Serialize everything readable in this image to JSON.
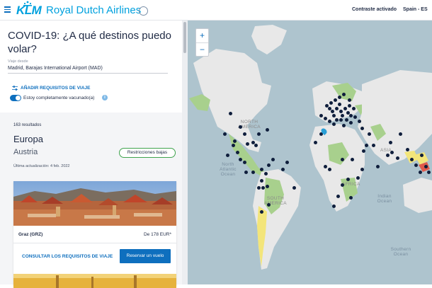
{
  "header": {
    "brand": "KLM",
    "airline_name": "Royal Dutch Airlines",
    "contrast_label": "Contraste activado",
    "language_label": "Spain - ES"
  },
  "sidebar": {
    "title": "COVID-19: ¿A qué destinos puedo volar?",
    "from_label": "Viaje desde",
    "from_value": "Madrid, Barajas International Airport (MAD)",
    "add_requirements": "AÑADIR REQUISITOS DE VIAJE",
    "vaccinated_label": "Estoy completamente vacunado(a)",
    "vaccinated_on": true,
    "info_glyph": "i",
    "results_count": "163 resultados",
    "region": "Europa",
    "country": "Austria",
    "restriction_badge": "Restricciones bajas",
    "last_update": "Última actualización: 4 feb. 2022",
    "destination": {
      "name": "Graz (GRZ)",
      "price": "De 178 EUR*",
      "requirements_link": "CONSULTAR LOS REQUISITOS DE VIAJE",
      "book_button": "Reservar un vuelo"
    }
  },
  "map": {
    "zoom_in": "+",
    "zoom_out": "−",
    "labels": {
      "north_america": "NORTH AMERICA",
      "north_atlantic": "North Atlantic Ocean",
      "south_america": "SOUTH AMERICA",
      "africa": "AFRICA",
      "asia": "ASIA",
      "indian_ocean": "Indian Ocean",
      "southern_ocean": "Southern Ocean"
    },
    "colors": {
      "water": "#aec4ce",
      "land": "#e8e8e8",
      "open_green": "#a8d08d",
      "restricted_yellow": "#f3e57a",
      "closed_red": "#e05a4b",
      "destination_dot": "#0f1e3c",
      "origin_marker": "#2a9fd6"
    }
  }
}
